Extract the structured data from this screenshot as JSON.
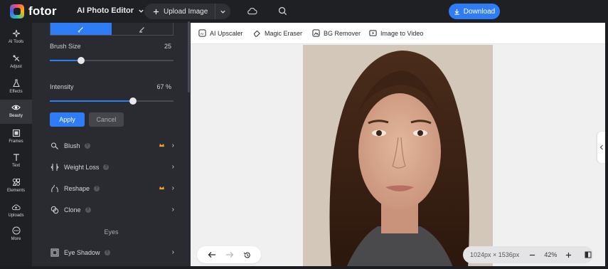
{
  "app": {
    "brand": "fotor",
    "title": "AI Photo Editor"
  },
  "header": {
    "upload_label": "Upload Image",
    "download_label": "Download"
  },
  "rail": [
    {
      "label": "AI Tools",
      "icon": "sparkle-icon"
    },
    {
      "label": "Adjust",
      "icon": "adjust-icon"
    },
    {
      "label": "Effects",
      "icon": "flask-icon"
    },
    {
      "label": "Beauty",
      "icon": "eye-icon",
      "active": true
    },
    {
      "label": "Frames",
      "icon": "frame-icon"
    },
    {
      "label": "Text",
      "icon": "text-icon"
    },
    {
      "label": "Elements",
      "icon": "elements-icon"
    },
    {
      "label": "Uploads",
      "icon": "cloud-upload-icon"
    },
    {
      "label": "More",
      "icon": "more-icon"
    }
  ],
  "panel": {
    "brush_size": {
      "label": "Brush Size",
      "value": "25",
      "level": 0.25
    },
    "intensity": {
      "label": "Intensity",
      "value": "67 %",
      "level": 0.67
    },
    "apply_label": "Apply",
    "cancel_label": "Cancel",
    "tools": [
      {
        "label": "Blush",
        "icon": "blush-icon",
        "premium": true
      },
      {
        "label": "Weight Loss",
        "icon": "weight-loss-icon",
        "premium": false
      },
      {
        "label": "Reshape",
        "icon": "reshape-icon",
        "premium": true
      },
      {
        "label": "Clone",
        "icon": "clone-icon",
        "premium": false
      }
    ],
    "section_eyes": "Eyes",
    "eye_tool": {
      "label": "Eye Shadow",
      "icon": "eye-shadow-icon"
    }
  },
  "toolbar": [
    {
      "label": "AI Upscaler",
      "icon": "upscale-icon"
    },
    {
      "label": "Magic Eraser",
      "icon": "eraser-icon"
    },
    {
      "label": "BG Remover",
      "icon": "bg-remover-icon"
    },
    {
      "label": "Image to Video",
      "icon": "video-icon"
    }
  ],
  "canvas": {
    "dimensions": "1024px × 1536px",
    "zoom": "42%"
  },
  "colors": {
    "accent": "#2f7df6",
    "sidebar": "#2a2b30",
    "topbar": "#1f2024"
  }
}
